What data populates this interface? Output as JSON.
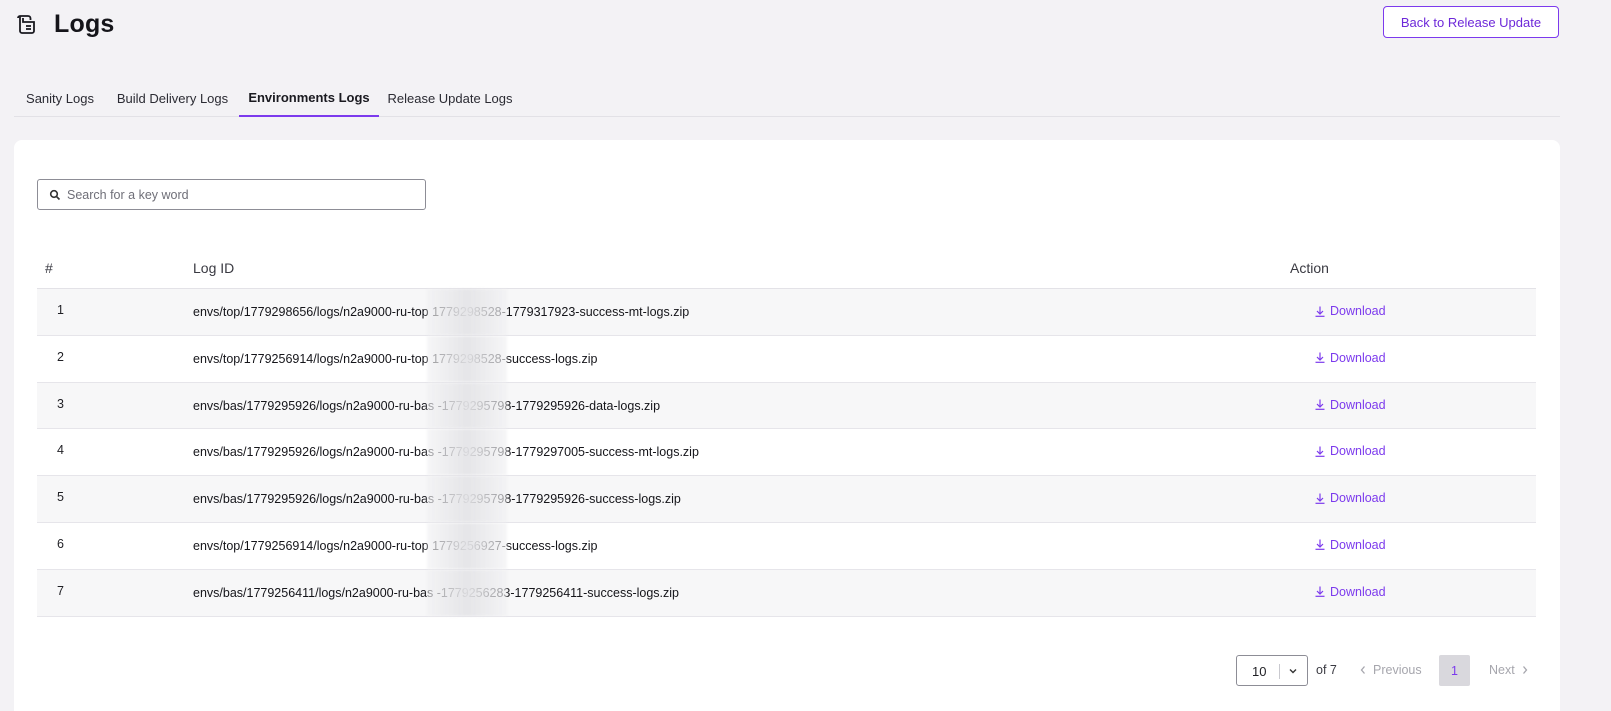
{
  "header": {
    "title": "Logs",
    "back_button": "Back to Release Update"
  },
  "tabs": [
    {
      "label": "Sanity Logs",
      "active": false
    },
    {
      "label": "Build Delivery Logs",
      "active": false
    },
    {
      "label": "Environments Logs",
      "active": true
    },
    {
      "label": "Release Update Logs",
      "active": false
    }
  ],
  "search": {
    "placeholder": "Search for a key word",
    "value": ""
  },
  "table": {
    "columns": [
      "#",
      "Log ID",
      "Action"
    ],
    "action_label": "Download",
    "rows": [
      {
        "num": "1",
        "log_id": "envs/top/1779298656/logs/n2a9000-ru-top            1779298528-1779317923-success-mt-logs.zip"
      },
      {
        "num": "2",
        "log_id": "envs/top/1779256914/logs/n2a9000-ru-top            1779298528-success-logs.zip"
      },
      {
        "num": "3",
        "log_id": "envs/bas/1779295926/logs/n2a9000-ru-bas            -1779295798-1779295926-data-logs.zip"
      },
      {
        "num": "4",
        "log_id": "envs/bas/1779295926/logs/n2a9000-ru-bas            -1779295798-1779297005-success-mt-logs.zip"
      },
      {
        "num": "5",
        "log_id": "envs/bas/1779295926/logs/n2a9000-ru-bas            -1779295798-1779295926-success-logs.zip"
      },
      {
        "num": "6",
        "log_id": "envs/top/1779256914/logs/n2a9000-ru-top            1779256927-success-logs.zip"
      },
      {
        "num": "7",
        "log_id": "envs/bas/1779256411/logs/n2a9000-ru-bas            -1779256283-1779256411-success-logs.zip"
      }
    ]
  },
  "pagination": {
    "page_size": "10",
    "of_label": "of 7",
    "previous": "Previous",
    "current_page": "1",
    "next": "Next"
  },
  "colors": {
    "accent": "#7c3aed",
    "background": "#f3f2f5"
  }
}
